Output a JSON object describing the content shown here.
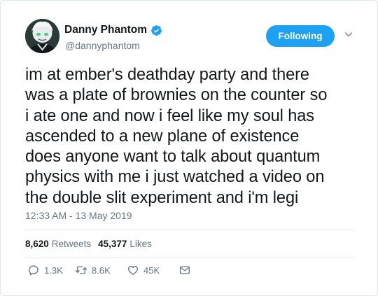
{
  "user": {
    "display_name": "Danny Phantom",
    "handle": "@dannyphantom",
    "verified_icon": "verified-badge-icon"
  },
  "follow_button": {
    "label": "Following"
  },
  "tweet": {
    "text": "im at ember's deathday party and there\nwas a plate of brownies on the counter so\ni ate one and now i feel like my soul has\nascended to a new plane of existence\ndoes anyone want to talk about quantum\nphysics with me i just watched a video on\nthe double slit experiment and i'm legi",
    "timestamp": "12:33 AM - 13 May 2019"
  },
  "stats": {
    "retweets_count": "8,620",
    "retweets_label": "Retweets",
    "likes_count": "45,377",
    "likes_label": "Likes"
  },
  "actions": {
    "reply_count": "1.3K",
    "retweet_count": "8.6K",
    "like_count": "45K"
  },
  "colors": {
    "accent": "#1da1f2",
    "secondary_text": "#657786",
    "primary_text": "#14171a",
    "border": "#e1e8ed"
  }
}
